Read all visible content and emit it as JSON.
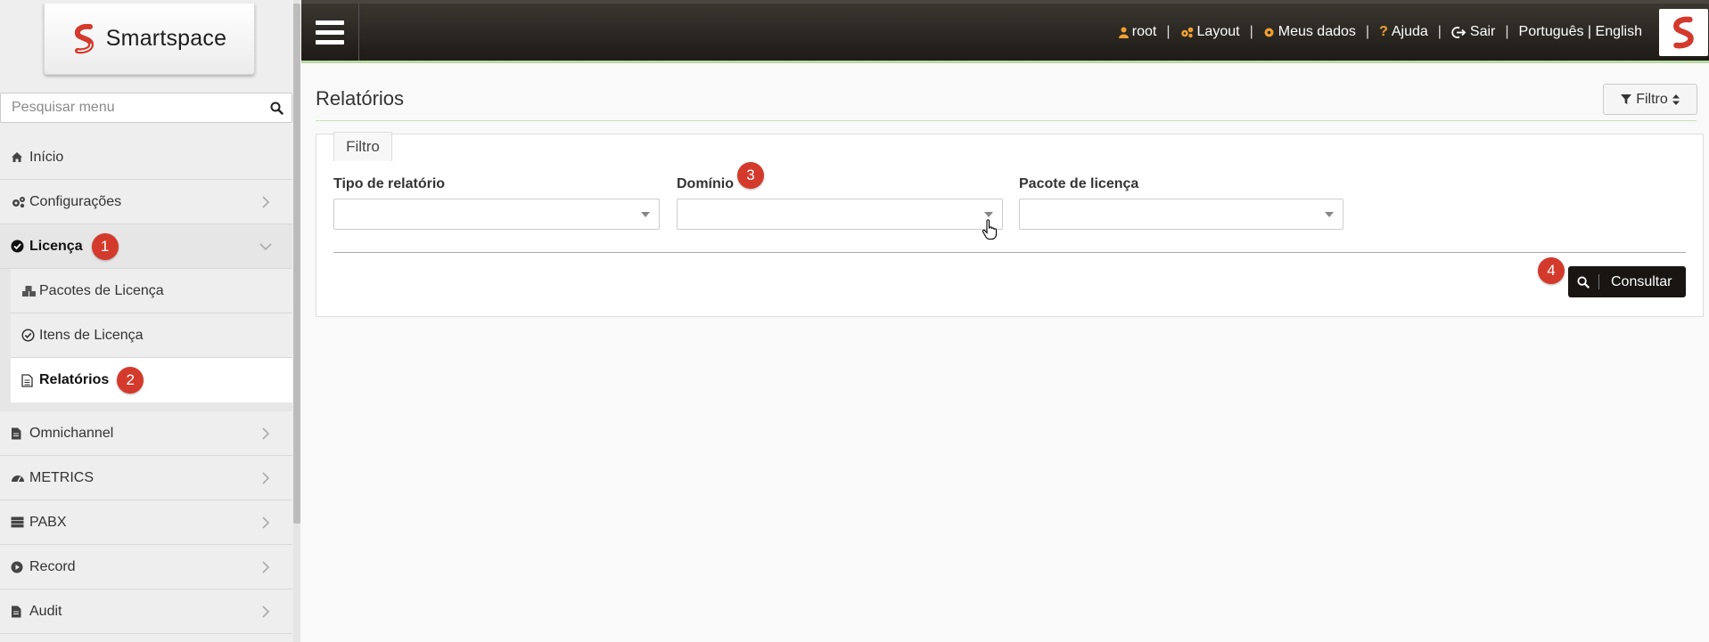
{
  "brand": {
    "name": "Smartspace"
  },
  "sidebar": {
    "search_placeholder": "Pesquisar menu",
    "items": [
      {
        "label": "Início",
        "icon": "home-icon"
      },
      {
        "label": "Configurações",
        "icon": "cogs-icon"
      },
      {
        "label": "Licença",
        "icon": "check-circle-icon",
        "badge": "1"
      },
      {
        "label": "Omnichannel",
        "icon": "file-icon"
      },
      {
        "label": "METRICS",
        "icon": "dashboard-icon"
      },
      {
        "label": "PABX",
        "icon": "server-icon"
      },
      {
        "label": "Record",
        "icon": "play-circle-icon"
      },
      {
        "label": "Audit",
        "icon": "file-icon"
      }
    ],
    "subitems": [
      {
        "label": "Pacotes de Licença",
        "icon": "cubes-icon"
      },
      {
        "label": "Itens de Licença",
        "icon": "check-circle-outline-icon"
      },
      {
        "label": "Relatórios",
        "icon": "file-text-icon",
        "badge": "2"
      }
    ]
  },
  "topbar": {
    "user": "root",
    "layout": "Layout",
    "my_data": "Meus dados",
    "help": "Ajuda",
    "logout": "Sair",
    "languages": "Português | English",
    "separator": "|"
  },
  "main": {
    "title": "Relatórios",
    "filter_toggle_label": "Filtro",
    "panel_tab_label": "Filtro",
    "fields": {
      "report_type_label": "Tipo de relatório",
      "domain_label": "Domínio",
      "domain_badge": "3",
      "license_package_label": "Pacote de licença"
    },
    "consult_button_label": "Consultar",
    "consult_badge": "4"
  },
  "colors": {
    "brand_red": "#d33a2c",
    "topbar_dark": "#2b2722",
    "accent_green": "#b8d9a4",
    "topnav_icon_orange": "#f0a030"
  }
}
